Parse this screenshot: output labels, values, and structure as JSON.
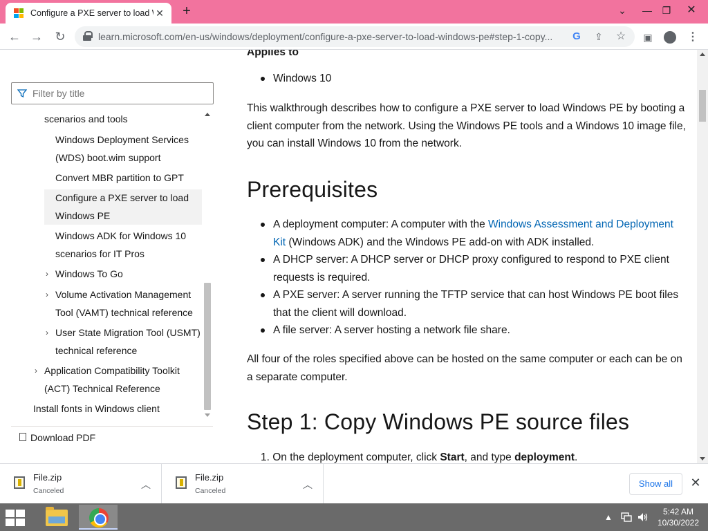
{
  "browser": {
    "tab_title": "Configure a PXE server to load W",
    "tab_close": "✕",
    "new_tab": "+",
    "url": "learn.microsoft.com/en-us/windows/deployment/configure-a-pxe-server-to-load-windows-pe#step-1-copy...",
    "window_controls": {
      "tab_search": "⌄",
      "minimize": "—",
      "maximize": "❐",
      "close": "✕"
    }
  },
  "toolbar": {
    "back": "←",
    "forward": "→",
    "reload": "↻",
    "google": "G",
    "share": "⇪",
    "star": "☆",
    "side_panel": "▣",
    "menu": "⋮"
  },
  "left_nav": {
    "filter_placeholder": "Filter by title",
    "items": [
      {
        "label": "scenarios and tools"
      },
      {
        "label": "Windows Deployment Services (WDS) boot.wim support"
      },
      {
        "label": "Convert MBR partition to GPT"
      },
      {
        "label": "Configure a PXE server to load Windows PE"
      },
      {
        "label": "Windows ADK for Windows 10 scenarios for IT Pros"
      },
      {
        "label": "Windows To Go"
      },
      {
        "label": "Volume Activation Management Tool (VAMT) technical reference"
      },
      {
        "label": "User State Migration Tool (USMT) technical reference"
      },
      {
        "label": "Application Compatibility Toolkit (ACT) Technical Reference"
      },
      {
        "label": "Install fonts in Windows client"
      }
    ],
    "download_pdf": "Download PDF"
  },
  "article": {
    "applies_to": "Applies to",
    "applies_items": [
      "Windows 10"
    ],
    "intro": "This walkthrough describes how to configure a PXE server to load Windows PE by booting a client computer from the network. Using the Windows PE tools and a Windows 10 image file, you can install Windows 10 from the network.",
    "prereq_heading": "Prerequisites",
    "prereq": {
      "item1_pre": "A deployment computer: A computer with the ",
      "item1_link": "Windows Assessment and Deployment Kit",
      "item1_post": " (Windows ADK) and the Windows PE add-on with ADK installed.",
      "item2": "A DHCP server: A DHCP server or DHCP proxy configured to respond to PXE client requests is required.",
      "item3": "A PXE server: A server running the TFTP service that can host Windows PE boot files that the client will download.",
      "item4": "A file server: A server hosting a network file share."
    },
    "roles_para": "All four of the roles specified above can be hosted on the same computer or each can be on a separate computer.",
    "step1_heading": "Step 1: Copy Windows PE source files",
    "step1": {
      "num": "1.",
      "pre": "On the deployment computer, click ",
      "b1": "Start",
      "mid": ", and type ",
      "b2": "deployment",
      "post": "."
    }
  },
  "downloads": [
    {
      "name": "File.zip",
      "status": "Canceled"
    },
    {
      "name": "File.zip",
      "status": "Canceled"
    }
  ],
  "show_all": "Show all",
  "shelf_close": "✕",
  "taskbar": {
    "tray_up": "▲",
    "time": "5:42 AM",
    "date": "10/30/2022"
  },
  "colors": {
    "tab_strip": "#f2739e",
    "link": "#0065b3",
    "taskbar": "#6a6a6a"
  }
}
